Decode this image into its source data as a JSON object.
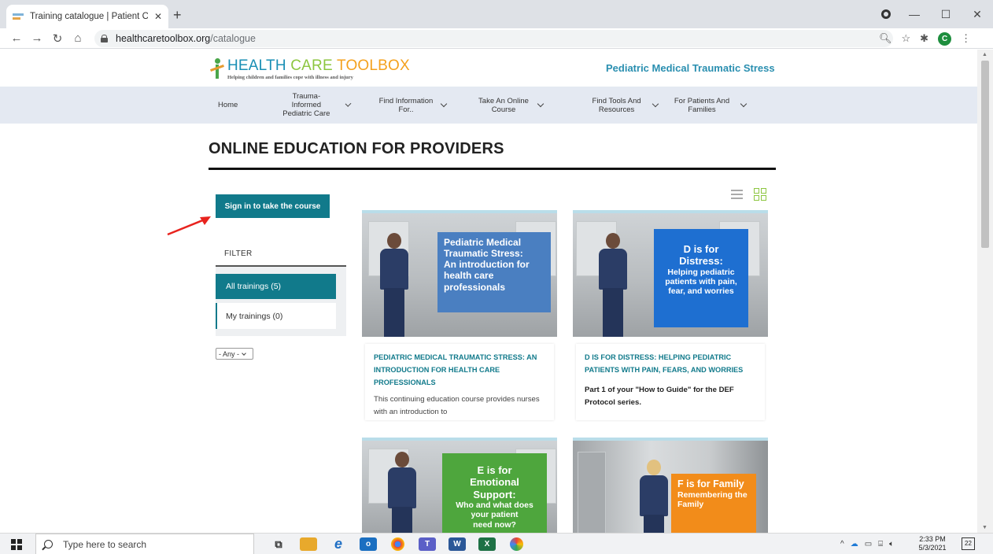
{
  "browser": {
    "tab_title": "Training catalogue | Patient Centr",
    "tab_close": "✕",
    "new_tab": "+",
    "url_host": "healthcaretoolbox.org",
    "url_path": "/catalogue",
    "profile_initial": "C",
    "window_controls": [
      "—",
      "☐",
      "✕"
    ]
  },
  "site": {
    "logo_parts": [
      "HEALTH",
      "CARE",
      "TOOLBOX"
    ],
    "logo_tagline": "Helping children and families cope with illness and injury",
    "tagline": "Pediatric Medical Traumatic Stress",
    "menu": [
      {
        "label": "Home",
        "dropdown": false
      },
      {
        "label": "Trauma-Informed Pediatric Care",
        "dropdown": true
      },
      {
        "label": "Find Information For..",
        "dropdown": true
      },
      {
        "label": "Take An Online Course",
        "dropdown": true
      },
      {
        "label": "Find Tools And Resources",
        "dropdown": true
      },
      {
        "label": "For Patients And Families",
        "dropdown": true
      }
    ]
  },
  "main": {
    "page_title": "ONLINE EDUCATION FOR PROVIDERS",
    "signin_label": "Sign in to take the course",
    "filter_label": "FILTER",
    "filter_all": "All trainings (5)",
    "filter_my": "My trainings (0)",
    "select_value": "- Any -",
    "annotation_color": "#e8231e"
  },
  "cards": [
    {
      "thumb_lines": [
        "Pediatric Medical",
        "Traumatic Stress:",
        "An introduction for",
        "health care",
        "professionals"
      ],
      "thumb_color": "#4a7fc1",
      "title": "PEDIATRIC MEDICAL TRAUMATIC STRESS: AN INTRODUCTION FOR HEALTH CARE PROFESSIONALS",
      "desc": "This continuing education course provides nurses with an introduction to"
    },
    {
      "thumb_lines": [
        "D is for Distress:",
        "Helping pediatric",
        "patients with pain,",
        "fear, and worries"
      ],
      "thumb_color": "#1e6fd1",
      "title": "D IS FOR DISTRESS: HELPING PEDIATRIC PATIENTS WITH PAIN, FEARS, AND WORRIES",
      "desc": "Part 1 of your \"How to Guide\" for the DEF Protocol series."
    },
    {
      "thumb_lines": [
        "E is for",
        "Emotional Support:",
        "Who and what does",
        "your patient",
        "need now?"
      ],
      "thumb_color": "#4ea63d"
    },
    {
      "thumb_lines": [
        "F is for Family",
        "Remembering the",
        "Family"
      ],
      "thumb_color": "#f28c1a"
    }
  ],
  "taskbar": {
    "search_placeholder": "Type here to search",
    "time": "2:33 PM",
    "date": "5/3/2021",
    "notification_count": "22"
  }
}
